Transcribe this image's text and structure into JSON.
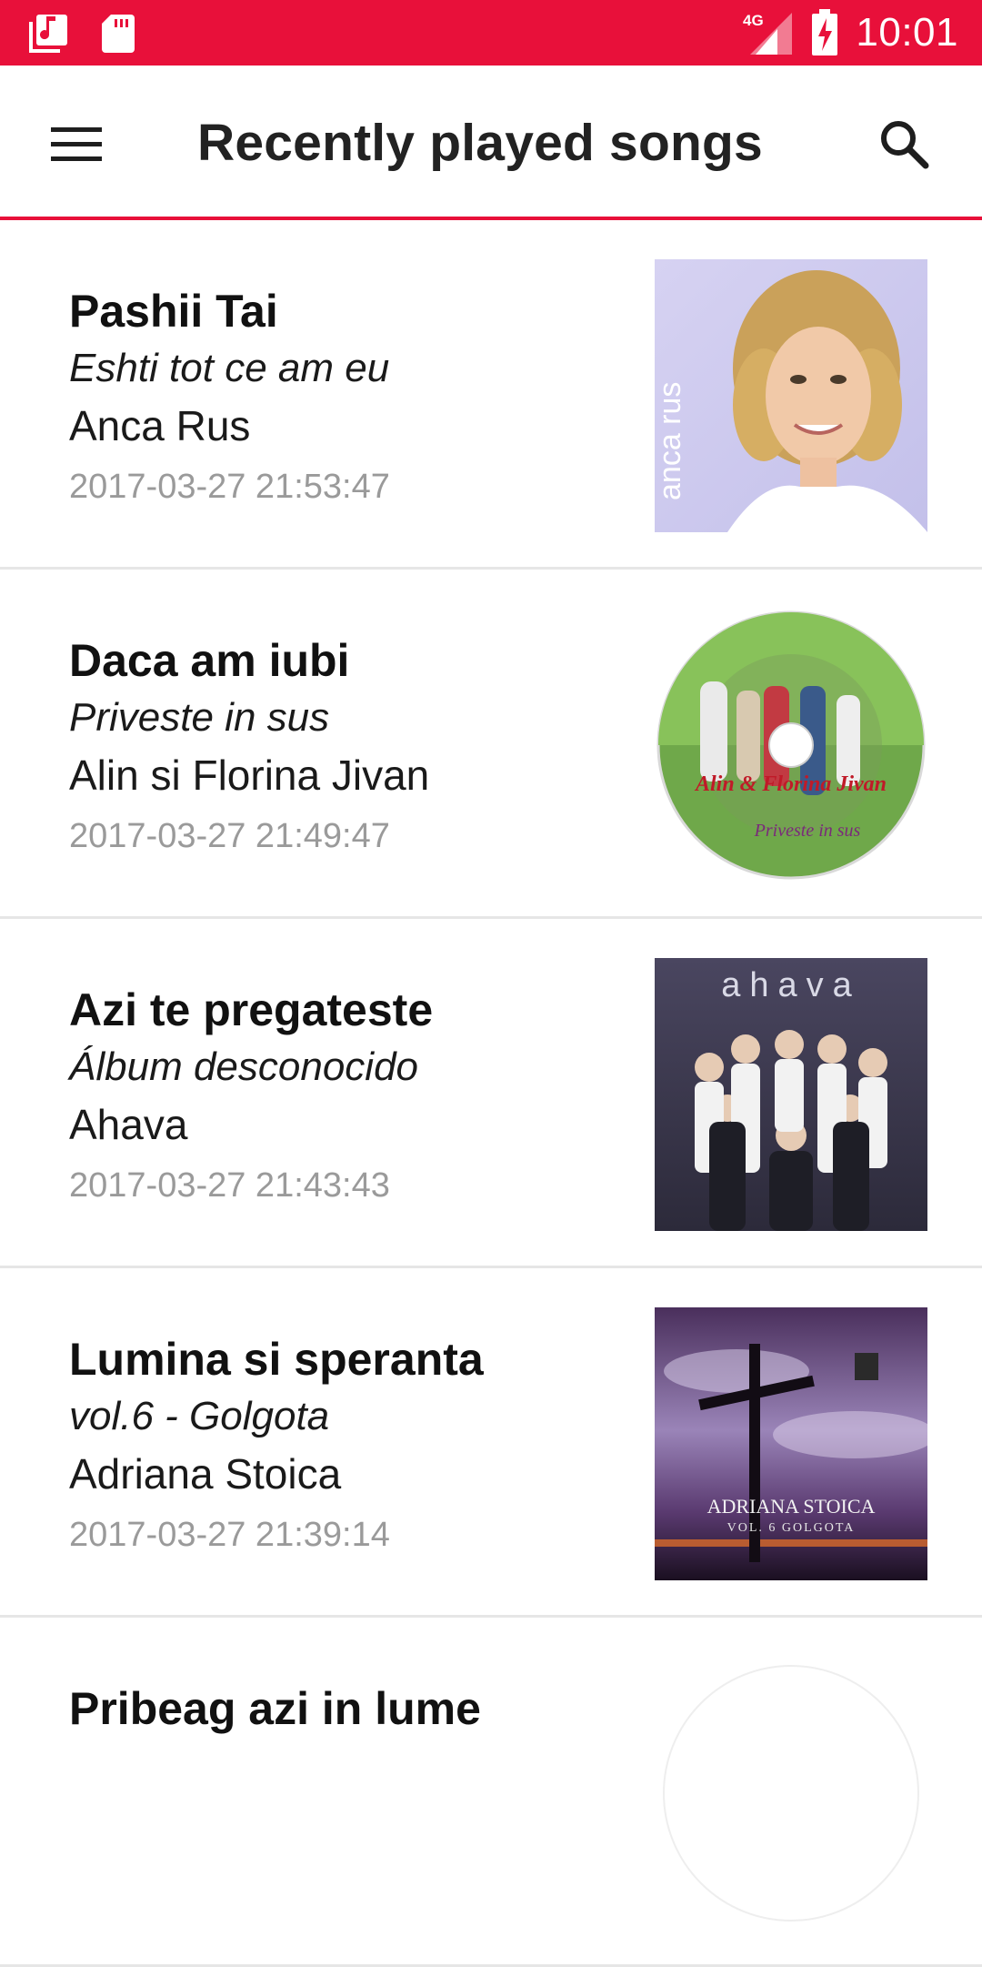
{
  "status_bar": {
    "left_icons": [
      "music-library-icon",
      "sd-card-icon"
    ],
    "network": "4G",
    "time": "10:01",
    "background": "#e8103a"
  },
  "app_bar": {
    "title": "Recently played songs",
    "menu_icon": "hamburger-menu-icon",
    "search_icon": "search-icon",
    "accent": "#e8103a"
  },
  "songs": [
    {
      "title": "Pashii Tai",
      "album": "Eshti tot ce am eu",
      "artist": "Anca Rus",
      "played_at": "2017-03-27 21:53:47",
      "cover_text": "anca rus"
    },
    {
      "title": "Daca am iubi",
      "album": "Priveste in sus",
      "artist": "Alin si Florina Jivan",
      "played_at": "2017-03-27 21:49:47",
      "cover_text": "Alin & Florina Jivan",
      "cover_subtext": "Priveste in sus"
    },
    {
      "title": "Azi te pregateste",
      "album": "Álbum desconocido",
      "artist": "Ahava",
      "played_at": "2017-03-27 21:43:43",
      "cover_text": "ahava"
    },
    {
      "title": "Lumina si speranta",
      "album": "vol.6 - Golgota",
      "artist": "Adriana Stoica",
      "played_at": "2017-03-27 21:39:14",
      "cover_text": "ADRIANA STOICA",
      "cover_subtext": "VOL. 6 GOLGOTA"
    },
    {
      "title": "Pribeag azi in lume"
    }
  ]
}
